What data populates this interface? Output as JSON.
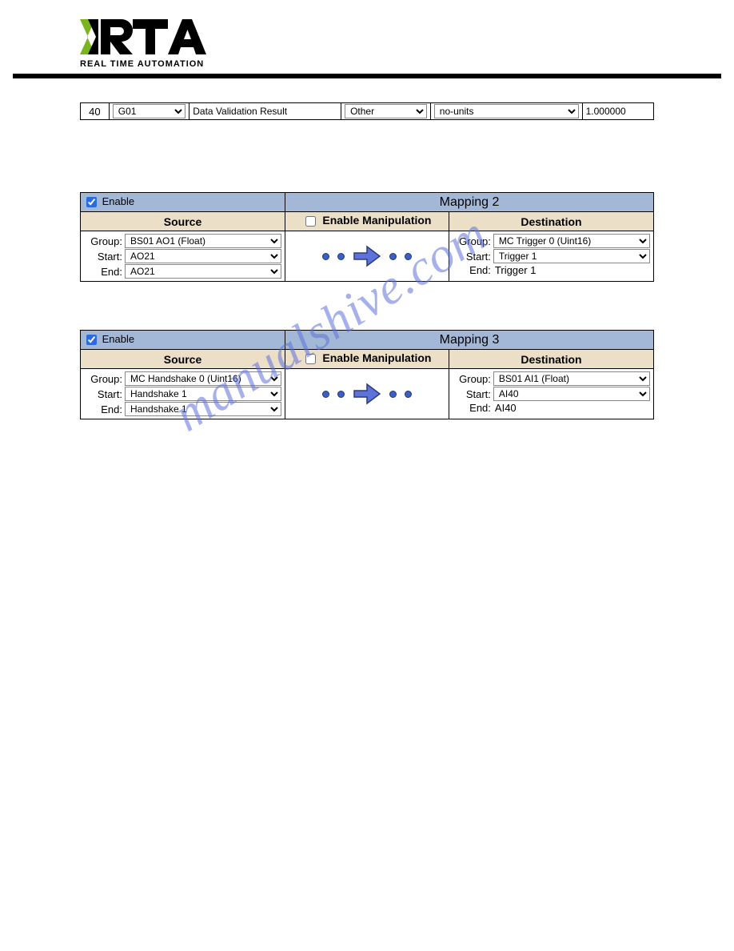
{
  "logo_tag": "REAL TIME AUTOMATION",
  "watermark": "manualshive.com",
  "top_row": {
    "num": "40",
    "sel1": "G01",
    "label": "Data Validation Result",
    "sel2": "Other",
    "sel3": "no-units",
    "value": "1.000000"
  },
  "mappings": [
    {
      "enable_checked": true,
      "enable_label": "Enable",
      "title": "Mapping 2",
      "source_hdr": "Source",
      "manip_label": "Enable Manipulation",
      "manip_checked": false,
      "dest_hdr": "Destination",
      "src": {
        "group_label": "Group:",
        "group": "BS01 AO1 (Float)",
        "start_label": "Start:",
        "start": "AO21",
        "end_label": "End:",
        "end": "AO21",
        "end_is_select": true
      },
      "dst": {
        "group_label": "Group:",
        "group": "MC Trigger 0 (Uint16)",
        "start_label": "Start:",
        "start": "Trigger 1",
        "end_label": "End:",
        "end": "Trigger 1",
        "end_is_select": false
      }
    },
    {
      "enable_checked": true,
      "enable_label": "Enable",
      "title": "Mapping 3",
      "source_hdr": "Source",
      "manip_label": "Enable Manipulation",
      "manip_checked": false,
      "dest_hdr": "Destination",
      "src": {
        "group_label": "Group:",
        "group": "MC Handshake 0 (Uint16)",
        "start_label": "Start:",
        "start": "Handshake 1",
        "end_label": "End:",
        "end": "Handshake 1",
        "end_is_select": true
      },
      "dst": {
        "group_label": "Group:",
        "group": "BS01 AI1 (Float)",
        "start_label": "Start:",
        "start": "AI40",
        "end_label": "End:",
        "end": "AI40",
        "end_is_select": false
      }
    }
  ]
}
